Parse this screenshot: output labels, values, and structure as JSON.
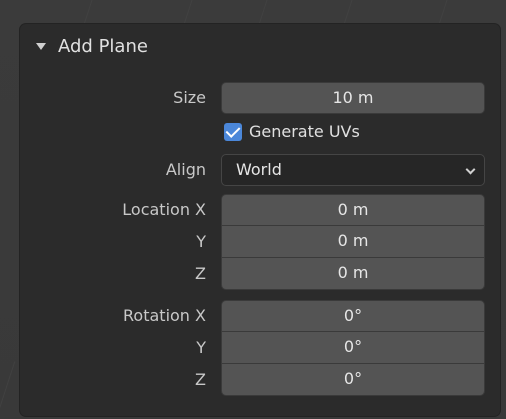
{
  "panel": {
    "title": "Add Plane",
    "size": {
      "label": "Size",
      "value": "10 m"
    },
    "generate_uvs": {
      "label": "Generate UVs",
      "checked": true
    },
    "align": {
      "label": "Align",
      "value": "World"
    },
    "location": {
      "x": {
        "label": "Location X",
        "value": "0 m"
      },
      "y": {
        "label": "Y",
        "value": "0 m"
      },
      "z": {
        "label": "Z",
        "value": "0 m"
      }
    },
    "rotation": {
      "x": {
        "label": "Rotation X",
        "value": "0°"
      },
      "y": {
        "label": "Y",
        "value": "0°"
      },
      "z": {
        "label": "Z",
        "value": "0°"
      }
    }
  },
  "colors": {
    "accent": "#4b87d9",
    "panel_bg": "#2b2b2b",
    "field_bg": "#545454"
  }
}
